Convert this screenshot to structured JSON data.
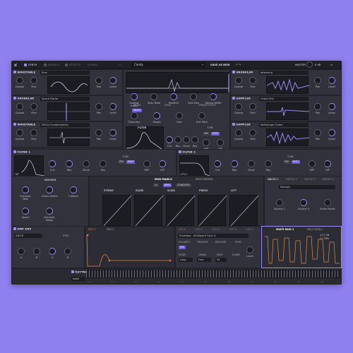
{
  "app": {
    "tabs": [
      {
        "label": "SYNTH",
        "active": true
      },
      {
        "label": "MODULE",
        "active": false
      },
      {
        "label": "EFFECTS",
        "active": false
      },
      {
        "label": "GLOBAL",
        "active": false
      }
    ],
    "preset_name": "Candy",
    "save_as": "SAVE AS",
    "new": "NEW",
    "master_label": "MASTER",
    "master_value": "0 dB"
  },
  "osc_left": [
    {
      "type": "WAVETABLE",
      "preset": "Sine",
      "knobs": [
        "Coarse",
        "Fine",
        "Pan",
        "Level"
      ]
    },
    {
      "type": "GRANULAR",
      "preset": "Space Flame",
      "knobs": [
        "Coarse",
        "Fine",
        "Pan",
        "Level"
      ]
    },
    {
      "type": "WAVETABLE",
      "preset": "DECar Fundamentals",
      "knobs": [
        "Coarse",
        "Fine",
        "Pan",
        "Level"
      ]
    }
  ],
  "center": {
    "knobs_top": [
      "Sample Index",
      "Scan Rate",
      "Position",
      "Grid Size",
      "Stereo Width"
    ],
    "mode_label": "MODE",
    "mode_value": "INDEX",
    "sync_label": "SYNC",
    "update_pitch": "UPDATE PITCH",
    "knobs_bottom": [
      "Direction",
      "Shape",
      "Size",
      "End Pitch"
    ],
    "filter_label": "FILTER",
    "filter_knobs": [
      "Cut",
      "Res",
      "Drive",
      "Key"
    ],
    "tone_label": "TONE",
    "tone_options": [
      "PRE",
      "POST"
    ],
    "hpf": "HPF",
    "lpf": "LPF"
  },
  "osc_right": [
    {
      "type": "GRANULAR",
      "preset": "Jetwaring",
      "knobs": [
        "Coarse",
        "Fine",
        "Pan",
        "Level"
      ]
    },
    {
      "type": "SAMPLER",
      "preset": "Chest Ohh",
      "knobs": [
        "Coarse",
        "Fine",
        "Pan",
        "Level"
      ]
    },
    {
      "type": "SAMPLER",
      "preset": "Multiscape Flutes",
      "knobs": [
        "Coarse",
        "Fine",
        "Pan",
        "Level"
      ]
    }
  ],
  "filter1": {
    "title": "FILTER 1",
    "type": "BP",
    "knobs": [
      "Cut",
      "Res",
      "Drive",
      "Key"
    ],
    "tone": "TONE",
    "tone_options": [
      "PRE",
      "POST"
    ],
    "hpf": "HPF",
    "lpf": "LPF"
  },
  "filter2": {
    "title": "FILTER 2",
    "type": "LP12",
    "knobs": [
      "Cut",
      "Res",
      "Drive",
      "Key"
    ],
    "tone": "TONE",
    "tone_options": [
      "PRE",
      "POST"
    ],
    "hpf": "HPF",
    "lpf": "LPF"
  },
  "macros": {
    "title": "MACROS",
    "knobs": [
      "Granular Melt",
      "Chaos Shake",
      "Colours",
      "Space",
      "Granular Delay"
    ]
  },
  "mod_panels": {
    "tab1": "MOD PANELS",
    "tab2": "MOD MATRIX",
    "sub_tabs": [
      "01",
      "APPS",
      "STANDARD"
    ],
    "lanes": [
      "STRIKE",
      "GLIDE",
      "SLIDE",
      "PRESS",
      "LIFT"
    ]
  },
  "macro1": {
    "tabs": [
      "MACRO 1",
      "MACRO 2",
      "MACRO 3",
      "MACRO 4"
    ],
    "preset": "Multiply",
    "knobs": [
      "Source 1",
      "Source 2",
      "Scale Factor"
    ]
  },
  "amp_env": {
    "title": "AMP ENV",
    "preset": "ADS-R",
    "sync": "SYNC",
    "labels": [
      "A",
      "D",
      "S",
      "R"
    ],
    "tabs": [
      "ENV 2",
      "ENV 3"
    ]
  },
  "lfo": {
    "tabs": [
      "LFO 1",
      "LFO 2",
      "LFO 3",
      "LFO 4",
      "LFO 5"
    ],
    "preset": "Envelope - Multipoint Sync A",
    "polarity": "POLARITY",
    "trigger": "TRIGGER",
    "release": "RELEASE",
    "sync": "SYNC",
    "mode_label": "MODE",
    "mode_value": "Loop",
    "grain_label": "GRAIN",
    "grain_value": "Free",
    "rate_label": "RATE",
    "rate_value": "32",
    "sharp_label": "SHAPE",
    "level": "Level",
    "uni": "UNI"
  },
  "multimod": {
    "tabs": [
      "MULTI-MOD 1",
      "MULTI-MOD 2"
    ],
    "value1": "1.3 / 16",
    "value2": "1 / 75%"
  },
  "keytracking": {
    "title": "KEYTRACKING",
    "preset": "Add2",
    "octaves": [
      "C-2",
      "C-1",
      "C0",
      "C1",
      "C2",
      "C3",
      "C4",
      "C5",
      "C6",
      "C7",
      "C8"
    ]
  },
  "colors": {
    "accent": "#9b8cf5",
    "background": "#8f80ef",
    "orange": "#e0894a",
    "panel": "#32323d"
  }
}
